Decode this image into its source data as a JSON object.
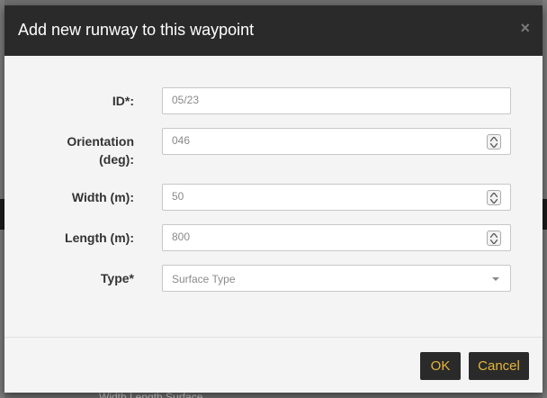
{
  "dialog": {
    "title": "Add new runway to this waypoint",
    "close_glyph": "×"
  },
  "fields": {
    "id": {
      "label": "ID*:",
      "value": "05/23"
    },
    "orientation": {
      "label_line1": "Orientation",
      "label_line2": "(deg):",
      "value": "046"
    },
    "width": {
      "label": "Width (m):",
      "value": "50"
    },
    "length": {
      "label": "Length (m):",
      "value": "800"
    },
    "type": {
      "label": "Type*",
      "placeholder": "Surface Type"
    }
  },
  "footer": {
    "ok_label": "OK",
    "cancel_label": "Cancel"
  },
  "background": {
    "partial_text": "Width                  Length                  Surface"
  },
  "colors": {
    "header_bg": "#2a2a2a",
    "button_bg": "#2a2a2a",
    "button_text": "#e8b53a",
    "body_bg": "#f4f4f4"
  },
  "icons": {
    "close": "close-icon",
    "spinner": "spinner-arrows-icon",
    "dropdown": "chevron-down-icon"
  }
}
